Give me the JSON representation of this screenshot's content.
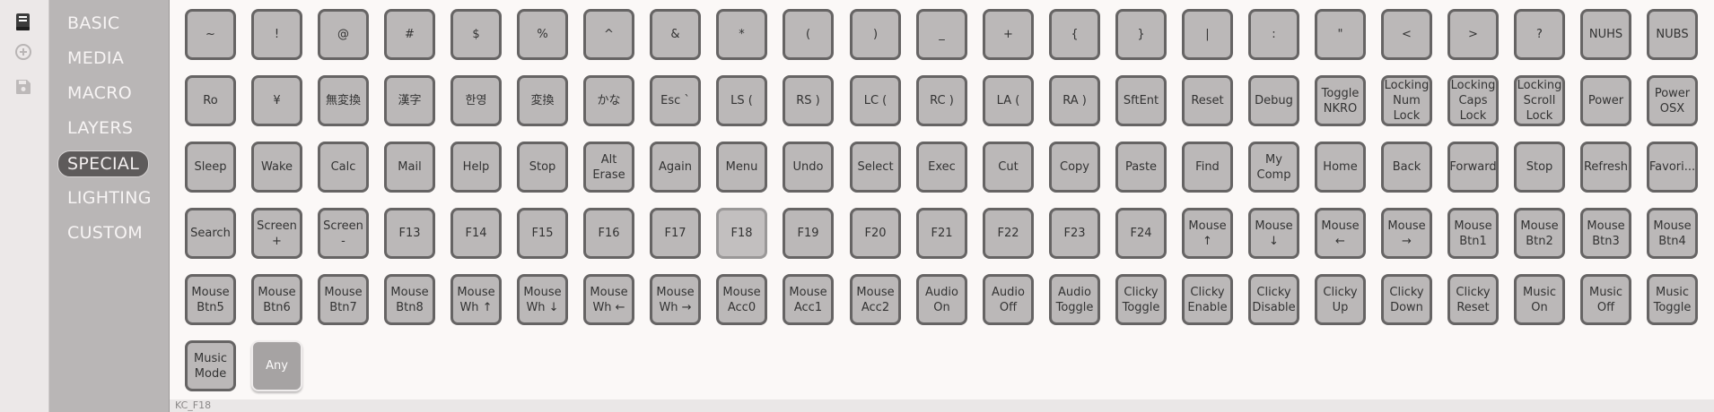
{
  "rail": {
    "icons": [
      {
        "name": "keyboard-book-icon",
        "active": true
      },
      {
        "name": "add-circle-icon",
        "active": false
      },
      {
        "name": "save-icon",
        "active": false
      }
    ]
  },
  "sidebar": {
    "categories": [
      {
        "label": "BASIC",
        "selected": false
      },
      {
        "label": "MEDIA",
        "selected": false
      },
      {
        "label": "MACRO",
        "selected": false
      },
      {
        "label": "LAYERS",
        "selected": false
      },
      {
        "label": "SPECIAL",
        "selected": true
      },
      {
        "label": "LIGHTING",
        "selected": false
      },
      {
        "label": "CUSTOM",
        "selected": false
      }
    ]
  },
  "keys": [
    [
      "~",
      "!",
      "@",
      "#",
      "$",
      "%",
      "^",
      "&",
      "*",
      "(",
      ")",
      "_",
      "+",
      "{",
      "}",
      "|",
      ":",
      "\"",
      "<",
      ">",
      "?",
      "NUHS",
      "NUBS"
    ],
    [
      "Ro",
      "¥",
      "無変換",
      "漢字",
      "한영",
      "変換",
      "かな",
      "Esc `",
      "LS (",
      "RS )",
      "LC (",
      "RC )",
      "LA (",
      "RA )",
      "SftEnt",
      "Reset",
      "Debug",
      "Toggle\nNKRO",
      "Locking\nNum\nLock",
      "Locking\nCaps\nLock",
      "Locking\nScroll\nLock",
      "Power",
      "Power\nOSX"
    ],
    [
      "Sleep",
      "Wake",
      "Calc",
      "Mail",
      "Help",
      "Stop",
      "Alt\nErase",
      "Again",
      "Menu",
      "Undo",
      "Select",
      "Exec",
      "Cut",
      "Copy",
      "Paste",
      "Find",
      "My\nComp",
      "Home",
      "Back",
      "Forward",
      "Stop",
      "Refresh",
      "Favori..."
    ],
    [
      "Search",
      "Screen\n+",
      "Screen\n-",
      "F13",
      "F14",
      "F15",
      "F16",
      "F17",
      "F18",
      "F19",
      "F20",
      "F21",
      "F22",
      "F23",
      "F24",
      "Mouse\n↑",
      "Mouse\n↓",
      "Mouse\n←",
      "Mouse\n→",
      "Mouse\nBtn1",
      "Mouse\nBtn2",
      "Mouse\nBtn3",
      "Mouse\nBtn4"
    ],
    [
      "Mouse\nBtn5",
      "Mouse\nBtn6",
      "Mouse\nBtn7",
      "Mouse\nBtn8",
      "Mouse\nWh ↑",
      "Mouse\nWh ↓",
      "Mouse\nWh ←",
      "Mouse\nWh →",
      "Mouse\nAcc0",
      "Mouse\nAcc1",
      "Mouse\nAcc2",
      "Audio\nOn",
      "Audio\nOff",
      "Audio\nToggle",
      "Clicky\nToggle",
      "Clicky\nEnable",
      "Clicky\nDisable",
      "Clicky\nUp",
      "Clicky\nDown",
      "Clicky\nReset",
      "Music\nOn",
      "Music\nOff",
      "Music\nToggle"
    ],
    [
      "Music\nMode",
      "Any"
    ]
  ],
  "hovered_key": "F18",
  "status_bar": {
    "text": "KC_F18"
  },
  "colors": {
    "key_fill": "#bbb8b8",
    "key_border": "#666464",
    "selected_category": "#5e5b5b",
    "sidebar": "#b9b6b6"
  }
}
